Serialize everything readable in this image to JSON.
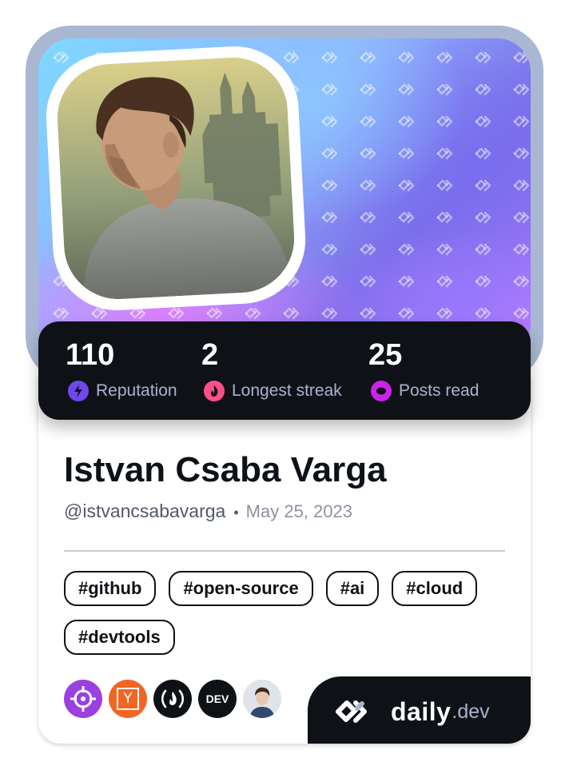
{
  "profile": {
    "name": "Istvan Csaba Varga",
    "handle": "@istvancsabavarga",
    "separator": "•",
    "joined": "May 25, 2023"
  },
  "stats": [
    {
      "value": "110",
      "label": "Reputation",
      "icon": "bolt-icon",
      "color": "#7147ed"
    },
    {
      "value": "2",
      "label": "Longest streak",
      "icon": "flame-icon",
      "color": "#ff4f8a"
    },
    {
      "value": "25",
      "label": "Posts read",
      "icon": "eye-ring-icon",
      "color": "#cb22e8"
    }
  ],
  "tags": [
    "#github",
    "#open-source",
    "#ai",
    "#cloud",
    "#devtools"
  ],
  "sources": [
    {
      "name": "crosshair-source-icon",
      "color": "#9b3fe0"
    },
    {
      "name": "hacker-news-icon",
      "letter": "Y",
      "color": "#f26522"
    },
    {
      "name": "freecodecamp-icon",
      "glyph": "(🔥)",
      "color": "#0e1217"
    },
    {
      "name": "dev-to-icon",
      "letter": "DEV",
      "color": "#0e1217"
    },
    {
      "name": "person-avatar-icon",
      "color": "#d9dde5"
    }
  ],
  "brand": {
    "daily": "daily",
    "dev": ".dev"
  },
  "colors": {
    "frame": "#a9b7d2",
    "dark": "#0e1217",
    "muted": "#a8b3cf"
  }
}
